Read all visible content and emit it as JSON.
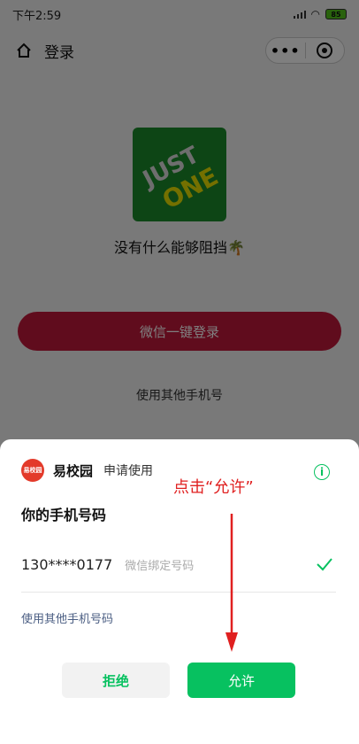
{
  "status_bar": {
    "time": "下午2:59",
    "battery": "85"
  },
  "nav": {
    "title": "登录"
  },
  "logo": {
    "line1": "JUST",
    "line2": "ONE"
  },
  "page": {
    "slogan": "没有什么能够阻挡🌴",
    "wechat_login": "微信一键登录",
    "other_phone": "使用其他手机号"
  },
  "sheet": {
    "app_icon_text": "易校园",
    "app_name": "易校园",
    "request": "申请使用",
    "title": "你的手机号码",
    "phone": "130****0177",
    "phone_desc": "微信绑定号码",
    "other_phone": "使用其他手机号码",
    "reject": "拒绝",
    "allow": "允许"
  },
  "annotation": {
    "text": "点击“允许”"
  },
  "colors": {
    "accent_green": "#07c160",
    "login_red": "#c0193a",
    "annotation_red": "#e02020"
  }
}
